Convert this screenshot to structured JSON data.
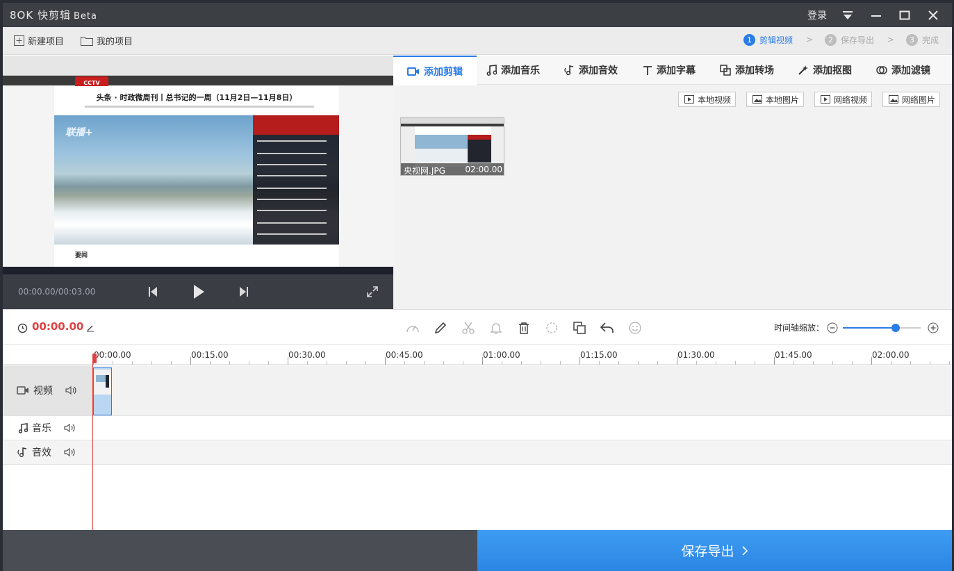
{
  "app": {
    "title": "快剪辑",
    "beta": "Beta",
    "login": "登录"
  },
  "toolbar": {
    "new_project": "新建项目",
    "my_projects": "我的项目"
  },
  "steps": [
    {
      "num": "1",
      "label": "剪辑视频"
    },
    {
      "num": "2",
      "label": "保存导出"
    },
    {
      "num": "3",
      "label": "完成"
    }
  ],
  "preview": {
    "time": "00:00.00/00:03.00",
    "screenshot": {
      "headline": "头条 · 时政微周刊丨总书记的一周（11月2日—11月8日）",
      "logo": "CCTV",
      "section": "要闻",
      "brand": "联播+"
    }
  },
  "tabs": [
    {
      "label": "添加剪辑",
      "icon": "video-camera-icon"
    },
    {
      "label": "添加音乐",
      "icon": "music-note-icon"
    },
    {
      "label": "添加音效",
      "icon": "sound-effect-icon"
    },
    {
      "label": "添加字幕",
      "icon": "text-icon"
    },
    {
      "label": "添加转场",
      "icon": "transition-icon"
    },
    {
      "label": "添加抠图",
      "icon": "magic-wand-icon"
    },
    {
      "label": "添加滤镜",
      "icon": "filter-icon"
    }
  ],
  "sources": [
    "本地视频",
    "本地图片",
    "网络视频",
    "网络图片"
  ],
  "clip": {
    "name": "央视网.JPG",
    "duration": "02:00.00"
  },
  "editbar": {
    "time": "00:00.00",
    "zoom_label": "时间轴缩放：",
    "zoom_level": 0.68
  },
  "ruler": [
    "00:00.00",
    "00:15.00",
    "00:30.00",
    "00:45.00",
    "01:00.00",
    "01:15.00",
    "01:30.00",
    "01:45.00",
    "02:00.00"
  ],
  "tracks": {
    "video": "视频",
    "music": "音乐",
    "sfx": "音效"
  },
  "export": {
    "label": "保存导出"
  }
}
